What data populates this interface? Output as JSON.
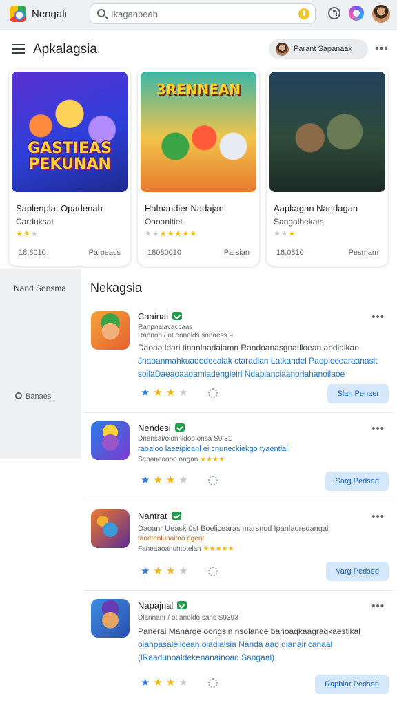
{
  "topbar": {
    "app_name": "Nengali",
    "search_placeholder": "Ikaganpeah",
    "icons": [
      "app-logo-icon",
      "search-icon",
      "mic-icon",
      "help-icon",
      "games-icon",
      "avatar"
    ]
  },
  "header": {
    "title": "Apkalagsia",
    "account_label": "Parant Sapanaak"
  },
  "featured": [
    {
      "art_text": "GASTIEAS PEKUNAN",
      "title": "Saplenplat Opadenah",
      "subtitle": "Carduksat",
      "stars": 2,
      "stat": "18,8010",
      "tag": "Parpeacs"
    },
    {
      "art_text": "3RENNEAN",
      "title": "Halnandier Nadajan",
      "subtitle": "Oaoanltiet",
      "stars": 5,
      "stat": "18080010",
      "tag": "Parsian"
    },
    {
      "art_text": "",
      "title": "Aapkagan Nandagan",
      "subtitle": "Sangalbekats",
      "stars": 2,
      "stat": "18,0810",
      "tag": "Pesmam"
    }
  ],
  "rail": {
    "heading": "Nand Sonsma",
    "item": "Banaes"
  },
  "list": {
    "title": "Nekagsia",
    "items": [
      {
        "name": "Caainai",
        "meta1": "Ranpnaiavaccaas",
        "meta2": "Rannon / ot onneids sonaess 9",
        "desc": "Daoaa ldari tinanlnadaiamn Randoanasgnatlloean apdlaikao",
        "blue1": "Jnaoanmahkuadedecalak ctaradian Latkandel Paoplocearaanasit",
        "blue2": "soilaDaeaoaaoamiadengleirl Ndapianciaanoriahanoilaoe",
        "action": "Slan Penaer"
      },
      {
        "name": "Nendesi",
        "meta1": "Dnensai/oionnldop onsa S9 31",
        "blue1": "raoaioo laeaipicanl ei cnuneckiekgo tyaentlal",
        "meta2": "Senaneaooe ongan",
        "action": "Sarg Pedsed"
      },
      {
        "name": "Nantrat",
        "meta1": "Daoanr Ueask 0st Boelicearas marsnod Ipanlaoredangail",
        "meta2": "taoetenlunaitoo dgent",
        "meta3": "Faneaaoanuntotelan",
        "action": "Varg Pedsed"
      },
      {
        "name": "Napajnal",
        "meta1": "Dlannanr / ot anoldo sans S9393",
        "desc": "Panerai Manarge oongsin nsolande banoaqkaagraqkaestikal",
        "blue1": "oiahpasaleilcean oiadlalsia Nanda aao dianairicanaal",
        "blue2": "(lRaadunoaldekenanainoad Sangaal)",
        "action": "Raphlar Pedsen"
      }
    ]
  },
  "colors": {
    "accent": "#1a73c8",
    "star": "#f2b600",
    "verified": "#1e9e4a",
    "action_bg": "#d5e8fb"
  }
}
